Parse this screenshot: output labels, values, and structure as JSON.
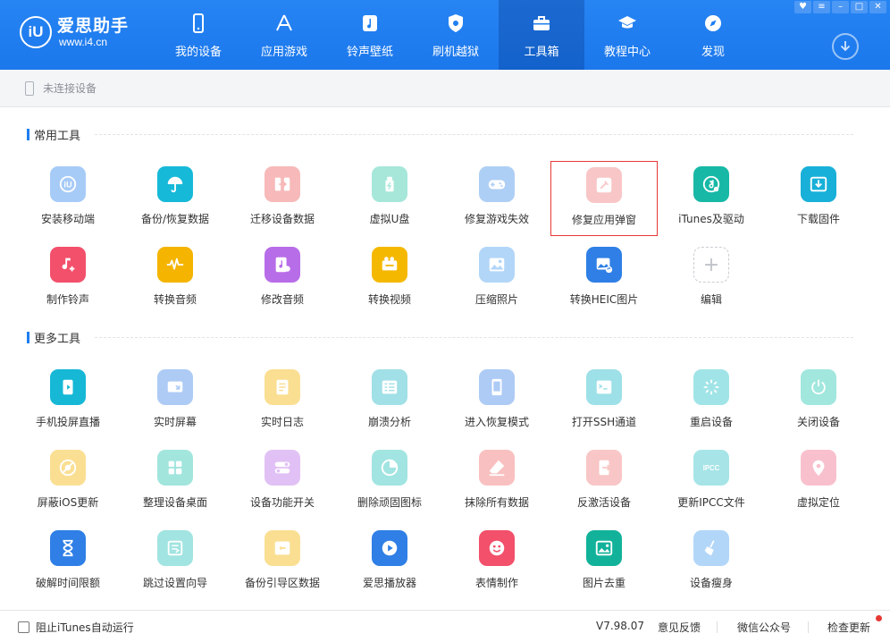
{
  "app": {
    "logo_mark": "iU",
    "name": "爱思助手",
    "url": "www.i4.cn"
  },
  "nav": [
    {
      "label": "我的设备",
      "icon": "phone-icon",
      "active": false
    },
    {
      "label": "应用游戏",
      "icon": "appstore-icon",
      "active": false
    },
    {
      "label": "铃声壁纸",
      "icon": "music-icon",
      "active": false
    },
    {
      "label": "刷机越狱",
      "icon": "shield-icon",
      "active": false
    },
    {
      "label": "工具箱",
      "icon": "toolbox-icon",
      "active": true
    },
    {
      "label": "教程中心",
      "icon": "graduation-cap-icon",
      "active": false
    },
    {
      "label": "发现",
      "icon": "compass-icon",
      "active": false
    }
  ],
  "device_status": "未连接设备",
  "sections": {
    "common": "常用工具",
    "more": "更多工具"
  },
  "common_tools": [
    {
      "label": "安装移动端",
      "icon": "i4-app-icon",
      "color": "#2f86ee",
      "faded": true
    },
    {
      "label": "备份/恢复数据",
      "icon": "umbrella-icon",
      "color": "#17b9d8",
      "faded": false
    },
    {
      "label": "迁移设备数据",
      "icon": "transfer-icon",
      "color": "#ee5a5a",
      "faded": true
    },
    {
      "label": "虚拟U盘",
      "icon": "usb-drive-icon",
      "color": "#2ec7a8",
      "faded": true
    },
    {
      "label": "修复游戏失效",
      "icon": "gamepad-icon",
      "color": "#3f8fe8",
      "faded": true
    },
    {
      "label": "修复应用弹窗",
      "icon": "app-repair-icon",
      "color": "#f07a7a",
      "faded": true,
      "selected": true
    },
    {
      "label": "iTunes及驱动",
      "icon": "itunes-icon",
      "color": "#18b8a6",
      "faded": false
    },
    {
      "label": "下载固件",
      "icon": "download-firmware-icon",
      "color": "#18b0d8",
      "faded": false
    },
    {
      "label": "制作铃声",
      "icon": "ringtone-icon",
      "color": "#f2506b",
      "faded": false
    },
    {
      "label": "转换音频",
      "icon": "audio-wave-icon",
      "color": "#f4b400",
      "faded": false
    },
    {
      "label": "修改音频",
      "icon": "audio-edit-icon",
      "color": "#b86de8",
      "faded": false
    },
    {
      "label": "转换视频",
      "icon": "video-convert-icon",
      "color": "#f5b800",
      "faded": false
    },
    {
      "label": "压缩照片",
      "icon": "photo-compress-icon",
      "color": "#4a9ef0",
      "faded": true
    },
    {
      "label": "转换HEIC图片",
      "icon": "heic-convert-icon",
      "color": "#2f7fe6",
      "faded": false
    },
    {
      "label": "编辑",
      "icon": "plus-icon",
      "color": "#c0c4c9",
      "faded": false,
      "add": true
    }
  ],
  "more_tools": [
    {
      "label": "手机投屏直播",
      "icon": "screen-cast-icon",
      "color": "#16b8d6",
      "faded": false
    },
    {
      "label": "实时屏幕",
      "icon": "realtime-screen-icon",
      "color": "#3f86e8",
      "faded": true
    },
    {
      "label": "实时日志",
      "icon": "log-icon",
      "color": "#f5b400",
      "faded": true
    },
    {
      "label": "崩溃分析",
      "icon": "crash-analysis-icon",
      "color": "#1fb7c4",
      "faded": true
    },
    {
      "label": "进入恢复模式",
      "icon": "recovery-mode-icon",
      "color": "#3f86e8",
      "faded": true
    },
    {
      "label": "打开SSH通道",
      "icon": "ssh-terminal-icon",
      "color": "#18b6c8",
      "faded": true
    },
    {
      "label": "重启设备",
      "icon": "restart-icon",
      "color": "#22c0c8",
      "faded": true
    },
    {
      "label": "关闭设备",
      "icon": "power-icon",
      "color": "#22c7b0",
      "faded": true
    },
    {
      "label": "屏蔽iOS更新",
      "icon": "block-update-icon",
      "color": "#f4b400",
      "faded": true
    },
    {
      "label": "整理设备桌面",
      "icon": "desktop-grid-icon",
      "color": "#22c3b0",
      "faded": true
    },
    {
      "label": "设备功能开关",
      "icon": "toggle-icon",
      "color": "#b86de8",
      "faded": true
    },
    {
      "label": "删除顽固图标",
      "icon": "delete-icon-pie-icon",
      "color": "#22c0b8",
      "faded": true
    },
    {
      "label": "抹除所有数据",
      "icon": "eraser-icon",
      "color": "#f06a6a",
      "faded": true
    },
    {
      "label": "反激活设备",
      "icon": "deactivate-icon",
      "color": "#f07a7a",
      "faded": true
    },
    {
      "label": "更新IPCC文件",
      "icon": "ipcc-icon",
      "color": "#2ec0c8",
      "faded": true
    },
    {
      "label": "虚拟定位",
      "icon": "location-pin-icon",
      "color": "#f06a8a",
      "faded": true
    },
    {
      "label": "破解时间限额",
      "icon": "hourglass-icon",
      "color": "#2f7fe6",
      "faded": false
    },
    {
      "label": "跳过设置向导",
      "icon": "skip-setup-icon",
      "color": "#22c0b8",
      "faded": true
    },
    {
      "label": "备份引导区数据",
      "icon": "boot-backup-icon",
      "color": "#f5b400",
      "faded": true
    },
    {
      "label": "爱思播放器",
      "icon": "play-icon",
      "color": "#2f7fe6",
      "faded": false
    },
    {
      "label": "表情制作",
      "icon": "emoji-icon",
      "color": "#f2506b",
      "faded": false
    },
    {
      "label": "图片去重",
      "icon": "image-dedupe-icon",
      "color": "#12b29a",
      "faded": false
    },
    {
      "label": "设备瘦身",
      "icon": "broom-icon",
      "color": "#4a9ef0",
      "faded": true
    }
  ],
  "footer": {
    "checkbox_label": "阻止iTunes自动运行",
    "version": "V7.98.07",
    "feedback": "意见反馈",
    "wechat": "微信公众号",
    "check_update": "检查更新"
  },
  "accent_color": "#1e7ef0"
}
